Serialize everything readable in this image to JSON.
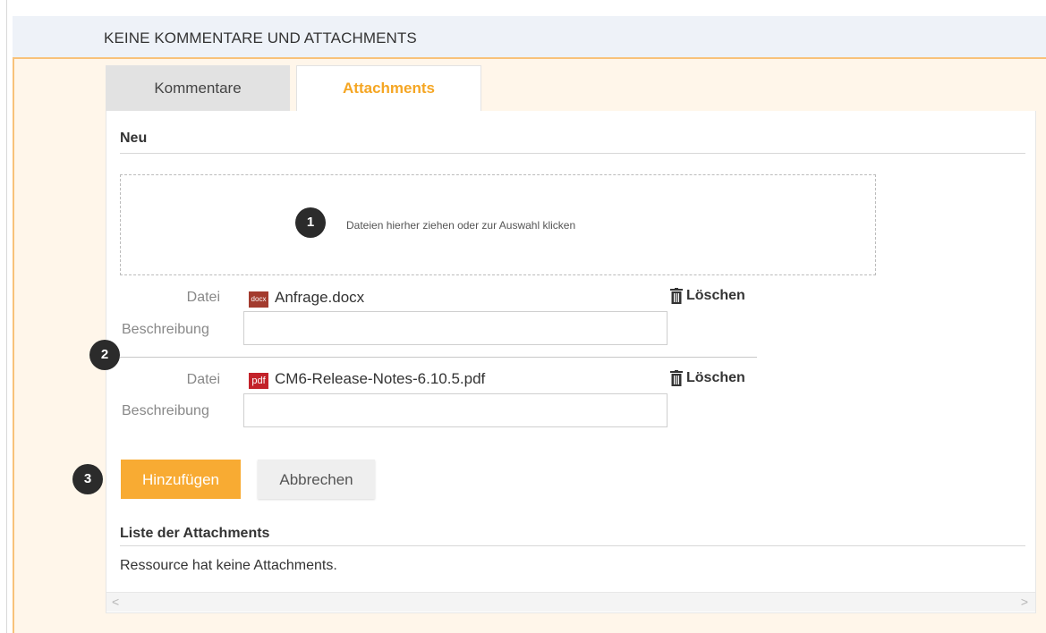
{
  "header": {
    "title": "KEINE KOMMENTARE UND ATTACHMENTS"
  },
  "tabs": [
    {
      "label": "Kommentare",
      "active": false
    },
    {
      "label": "Attachments",
      "active": true
    }
  ],
  "new_section": {
    "heading": "Neu",
    "dropzone_text": "Dateien hierher ziehen oder zur Auswahl klicken"
  },
  "markers": [
    "1",
    "2",
    "3"
  ],
  "files": [
    {
      "file_label": "Datei",
      "icon_text": "docx",
      "name": "Anfrage.docx",
      "delete_label": "Löschen",
      "desc_label": "Beschreibung",
      "desc_value": ""
    },
    {
      "file_label": "Datei",
      "icon_text": "pdf",
      "name": "CM6-Release-Notes-6.10.5.pdf",
      "delete_label": "Löschen",
      "desc_label": "Beschreibung",
      "desc_value": ""
    }
  ],
  "buttons": {
    "add": "Hinzufügen",
    "cancel": "Abbrechen"
  },
  "list_section": {
    "heading": "Liste der Attachments",
    "empty_text": "Ressource hat keine Attachments."
  },
  "scrollbar": {
    "left_arrow": "<",
    "right_arrow": ">"
  },
  "colors": {
    "accent": "#f8ab33",
    "tab_active_text": "#f5a623",
    "header_band": "#eef2f8",
    "panel_bg": "#fff6ea"
  },
  "icons": {
    "delete": "trash-icon",
    "docx": "docx-file-icon",
    "pdf": "pdf-file-icon"
  }
}
